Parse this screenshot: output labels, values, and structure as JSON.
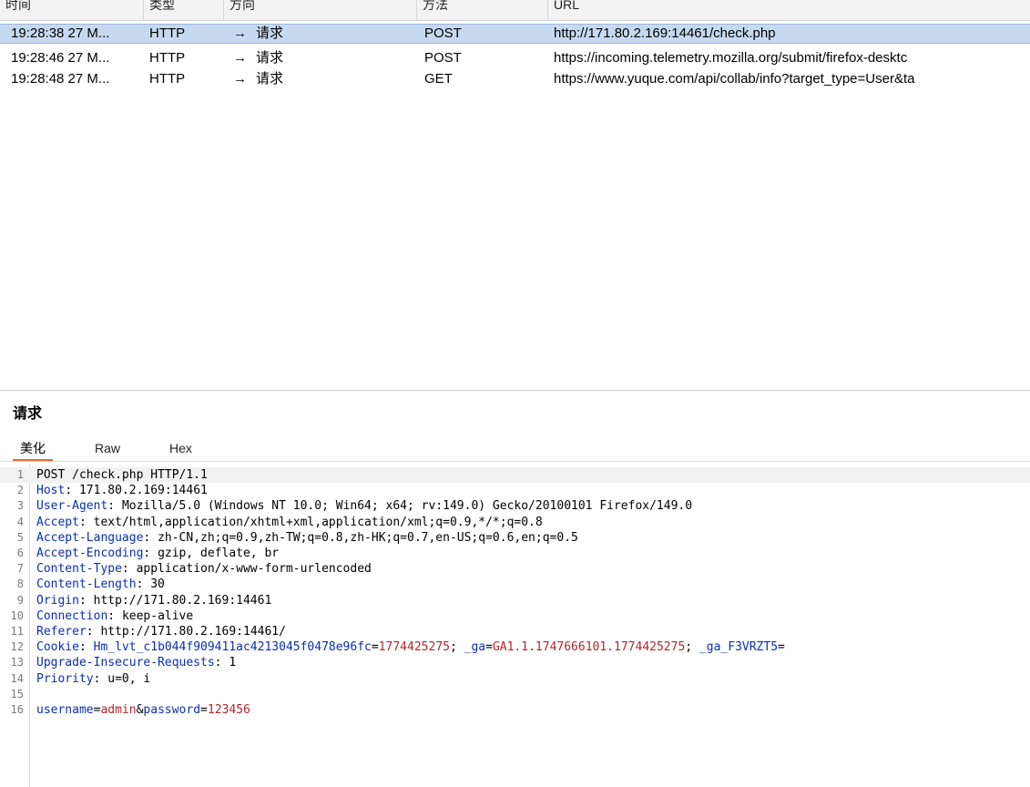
{
  "table": {
    "columns": [
      "时间",
      "类型",
      "方向",
      "方法",
      "URL"
    ],
    "rows": [
      {
        "time": "19:28:38 27 M...",
        "type": "HTTP",
        "arrow": "→",
        "direction": "请求",
        "method": "POST",
        "url": "http://171.80.2.169:14461/check.php",
        "selected": true
      },
      {
        "time": "19:28:46 27 M...",
        "type": "HTTP",
        "arrow": "→",
        "direction": "请求",
        "method": "POST",
        "url": "https://incoming.telemetry.mozilla.org/submit/firefox-desktc",
        "selected": false
      },
      {
        "time": "19:28:48 27 M...",
        "type": "HTTP",
        "arrow": "→",
        "direction": "请求",
        "method": "GET",
        "url": "https://www.yuque.com/api/collab/info?target_type=User&ta",
        "selected": false
      }
    ]
  },
  "panel": {
    "title": "请求",
    "tabs": [
      "美化",
      "Raw",
      "Hex"
    ],
    "active_tab": "美化"
  },
  "request": {
    "start_line": "POST /check.php HTTP/1.1",
    "headers": [
      {
        "name": "Host",
        "value": "171.80.2.169:14461"
      },
      {
        "name": "User-Agent",
        "value": "Mozilla/5.0 (Windows NT 10.0; Win64; x64; rv:149.0) Gecko/20100101 Firefox/149.0"
      },
      {
        "name": "Accept",
        "value": "text/html,application/xhtml+xml,application/xml;q=0.9,*/*;q=0.8"
      },
      {
        "name": "Accept-Language",
        "value": "zh-CN,zh;q=0.9,zh-TW;q=0.8,zh-HK;q=0.7,en-US;q=0.6,en;q=0.5"
      },
      {
        "name": "Accept-Encoding",
        "value": "gzip, deflate, br"
      },
      {
        "name": "Content-Type",
        "value": "application/x-www-form-urlencoded"
      },
      {
        "name": "Content-Length",
        "value": "30"
      },
      {
        "name": "Origin",
        "value": "http://171.80.2.169:14461"
      },
      {
        "name": "Connection",
        "value": "keep-alive"
      },
      {
        "name": "Referer",
        "value": "http://171.80.2.169:14461/"
      },
      {
        "name": "Cookie",
        "value": "",
        "cookies": [
          {
            "k": "Hm_lvt_c1b044f909411ac4213045f0478e96fc",
            "v": "1774425275",
            "sep": "; "
          },
          {
            "k": "_ga",
            "v": "GA1.1.1747666101.1774425275",
            "sep": "; "
          },
          {
            "k": "_ga_F3VRZT5",
            "v": "",
            "sep": ""
          }
        ]
      },
      {
        "name": "Upgrade-Insecure-Requests",
        "value": "1"
      },
      {
        "name": "Priority",
        "value": "u=0, i"
      }
    ],
    "body": [
      {
        "k": "username",
        "v": "admin"
      },
      {
        "k": "password",
        "v": "123456"
      }
    ]
  }
}
